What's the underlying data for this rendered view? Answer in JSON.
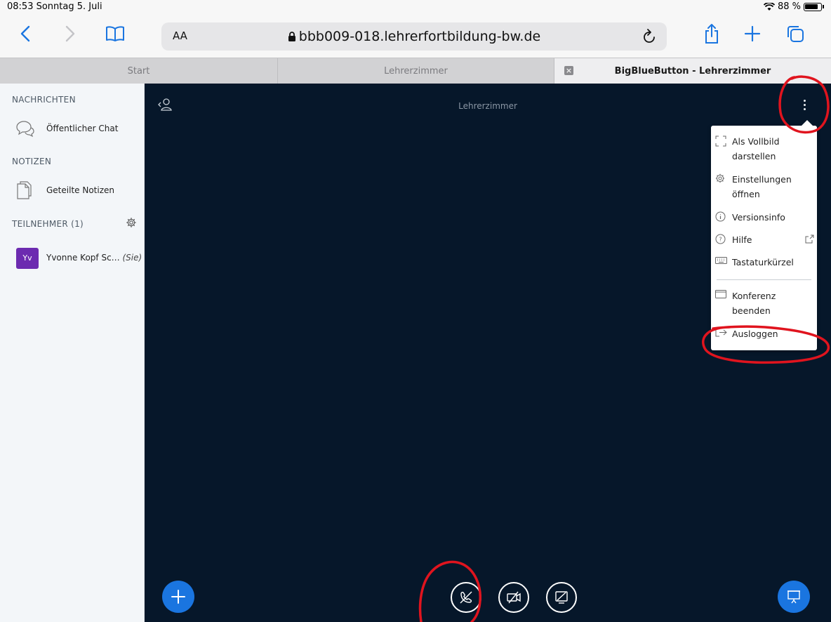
{
  "status": {
    "time_date": "08:53  Sonntag 5. Juli",
    "battery": "88 %"
  },
  "browser": {
    "text_size_label": "AA",
    "url": "bbb009-018.lehrerfortbildung-bw.de",
    "icons": [
      "back-icon",
      "forward-icon",
      "bookmarks-icon",
      "reload-icon",
      "share-icon",
      "new-tab-icon",
      "tabs-icon"
    ]
  },
  "tabs": [
    {
      "label": "Start"
    },
    {
      "label": "Lehrerzimmer"
    },
    {
      "label": "BigBlueButton - Lehrerzimmer"
    }
  ],
  "sidebar": {
    "messages_title": "NACHRICHTEN",
    "public_chat": "Öffentlicher Chat",
    "notes_title": "NOTIZEN",
    "shared_notes": "Geteilte Notizen",
    "participants_title": "TEILNEHMER (1)",
    "user": {
      "initials": "Yv",
      "name": "Yvonne Kopf Sc…",
      "suffix": "(Sie)"
    }
  },
  "main": {
    "room_title": "Lehrerzimmer"
  },
  "menu": {
    "fullscreen": "Als Vollbild darstellen",
    "settings": "Einstellungen öffnen",
    "version": "Versionsinfo",
    "help": "Hilfe",
    "shortcuts": "Tastaturkürzel",
    "end_meeting": "Konferenz beenden",
    "logout": "Ausloggen"
  },
  "colors": {
    "accent": "#1a75e0",
    "main_bg": "#06172a",
    "sidebar_bg": "#f3f6f9",
    "avatar": "#6c2bb0",
    "annotation": "#e0141e"
  }
}
